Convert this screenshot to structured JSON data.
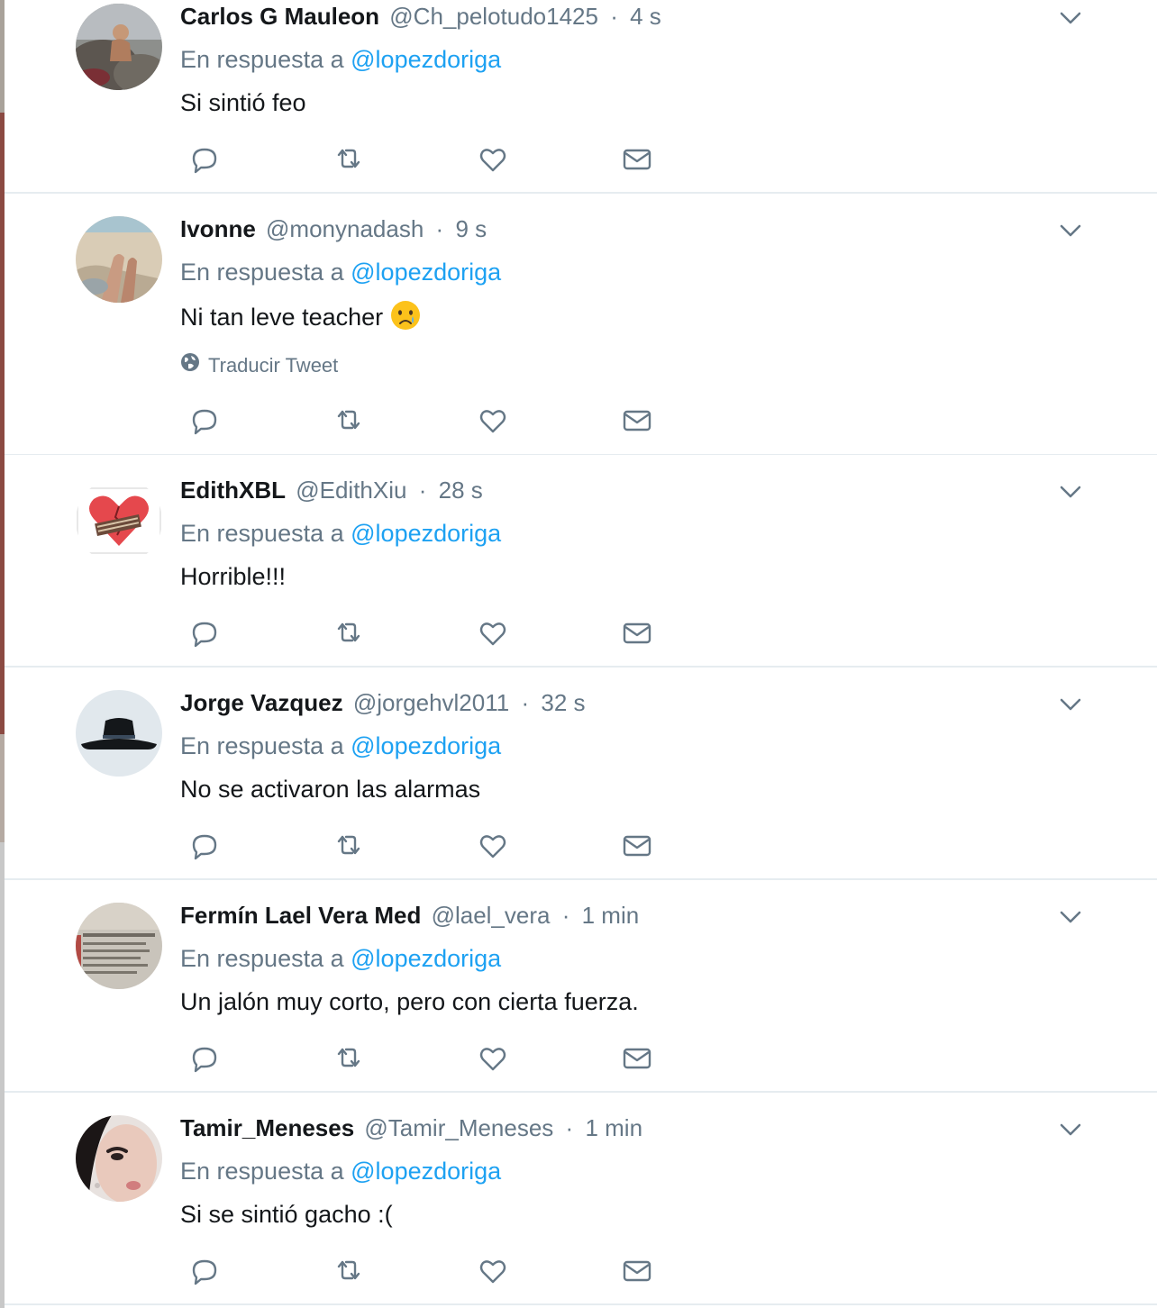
{
  "colors": {
    "link": "#1da1f2",
    "text": "#14171a",
    "muted": "#657786",
    "divider": "#e6ecf0"
  },
  "tweets": [
    {
      "name": "Carlos G Mauleon",
      "handle": "@Ch_pelotudo1425",
      "time": "4 s",
      "reply_prefix": "En respuesta a",
      "reply_to": "@lopezdoriga",
      "text": "Si sintió feo",
      "avatar": "photo-man-rocks"
    },
    {
      "name": "Ivonne",
      "handle": "@monynadash",
      "time": "9 s",
      "reply_prefix": "En respuesta a",
      "reply_to": "@lopezdoriga",
      "text": "Ni tan leve teacher",
      "emoji": "crying-face-emoji",
      "translate": "Traducir Tweet",
      "avatar": "photo-beach-legs"
    },
    {
      "name": "EdithXBL",
      "handle": "@EdithXiu",
      "time": "28 s",
      "reply_prefix": "En respuesta a",
      "reply_to": "@lopezdoriga",
      "text": "Horrible!!!",
      "avatar": "broken-heart-image"
    },
    {
      "name": "Jorge Vazquez",
      "handle": "@jorgehvl2011",
      "time": "32 s",
      "reply_prefix": "En respuesta a",
      "reply_to": "@lopezdoriga",
      "text": "No se activaron las alarmas",
      "avatar": "hat-icon"
    },
    {
      "name": "Fermín Lael Vera Med",
      "handle": "@lael_vera",
      "time": "1 min",
      "reply_prefix": "En respuesta a",
      "reply_to": "@lopezdoriga",
      "text": "Un jalón muy corto, pero con cierta fuerza.",
      "avatar": "photo-document"
    },
    {
      "name": "Tamir_Meneses",
      "handle": "@Tamir_Meneses",
      "time": "1 min",
      "reply_prefix": "En respuesta a",
      "reply_to": "@lopezdoriga",
      "text": "Si se sintió gacho :(",
      "avatar": "photo-woman-face"
    }
  ],
  "actions": [
    "reply-icon",
    "retweet-icon",
    "like-icon",
    "message-icon"
  ],
  "sep": "·"
}
